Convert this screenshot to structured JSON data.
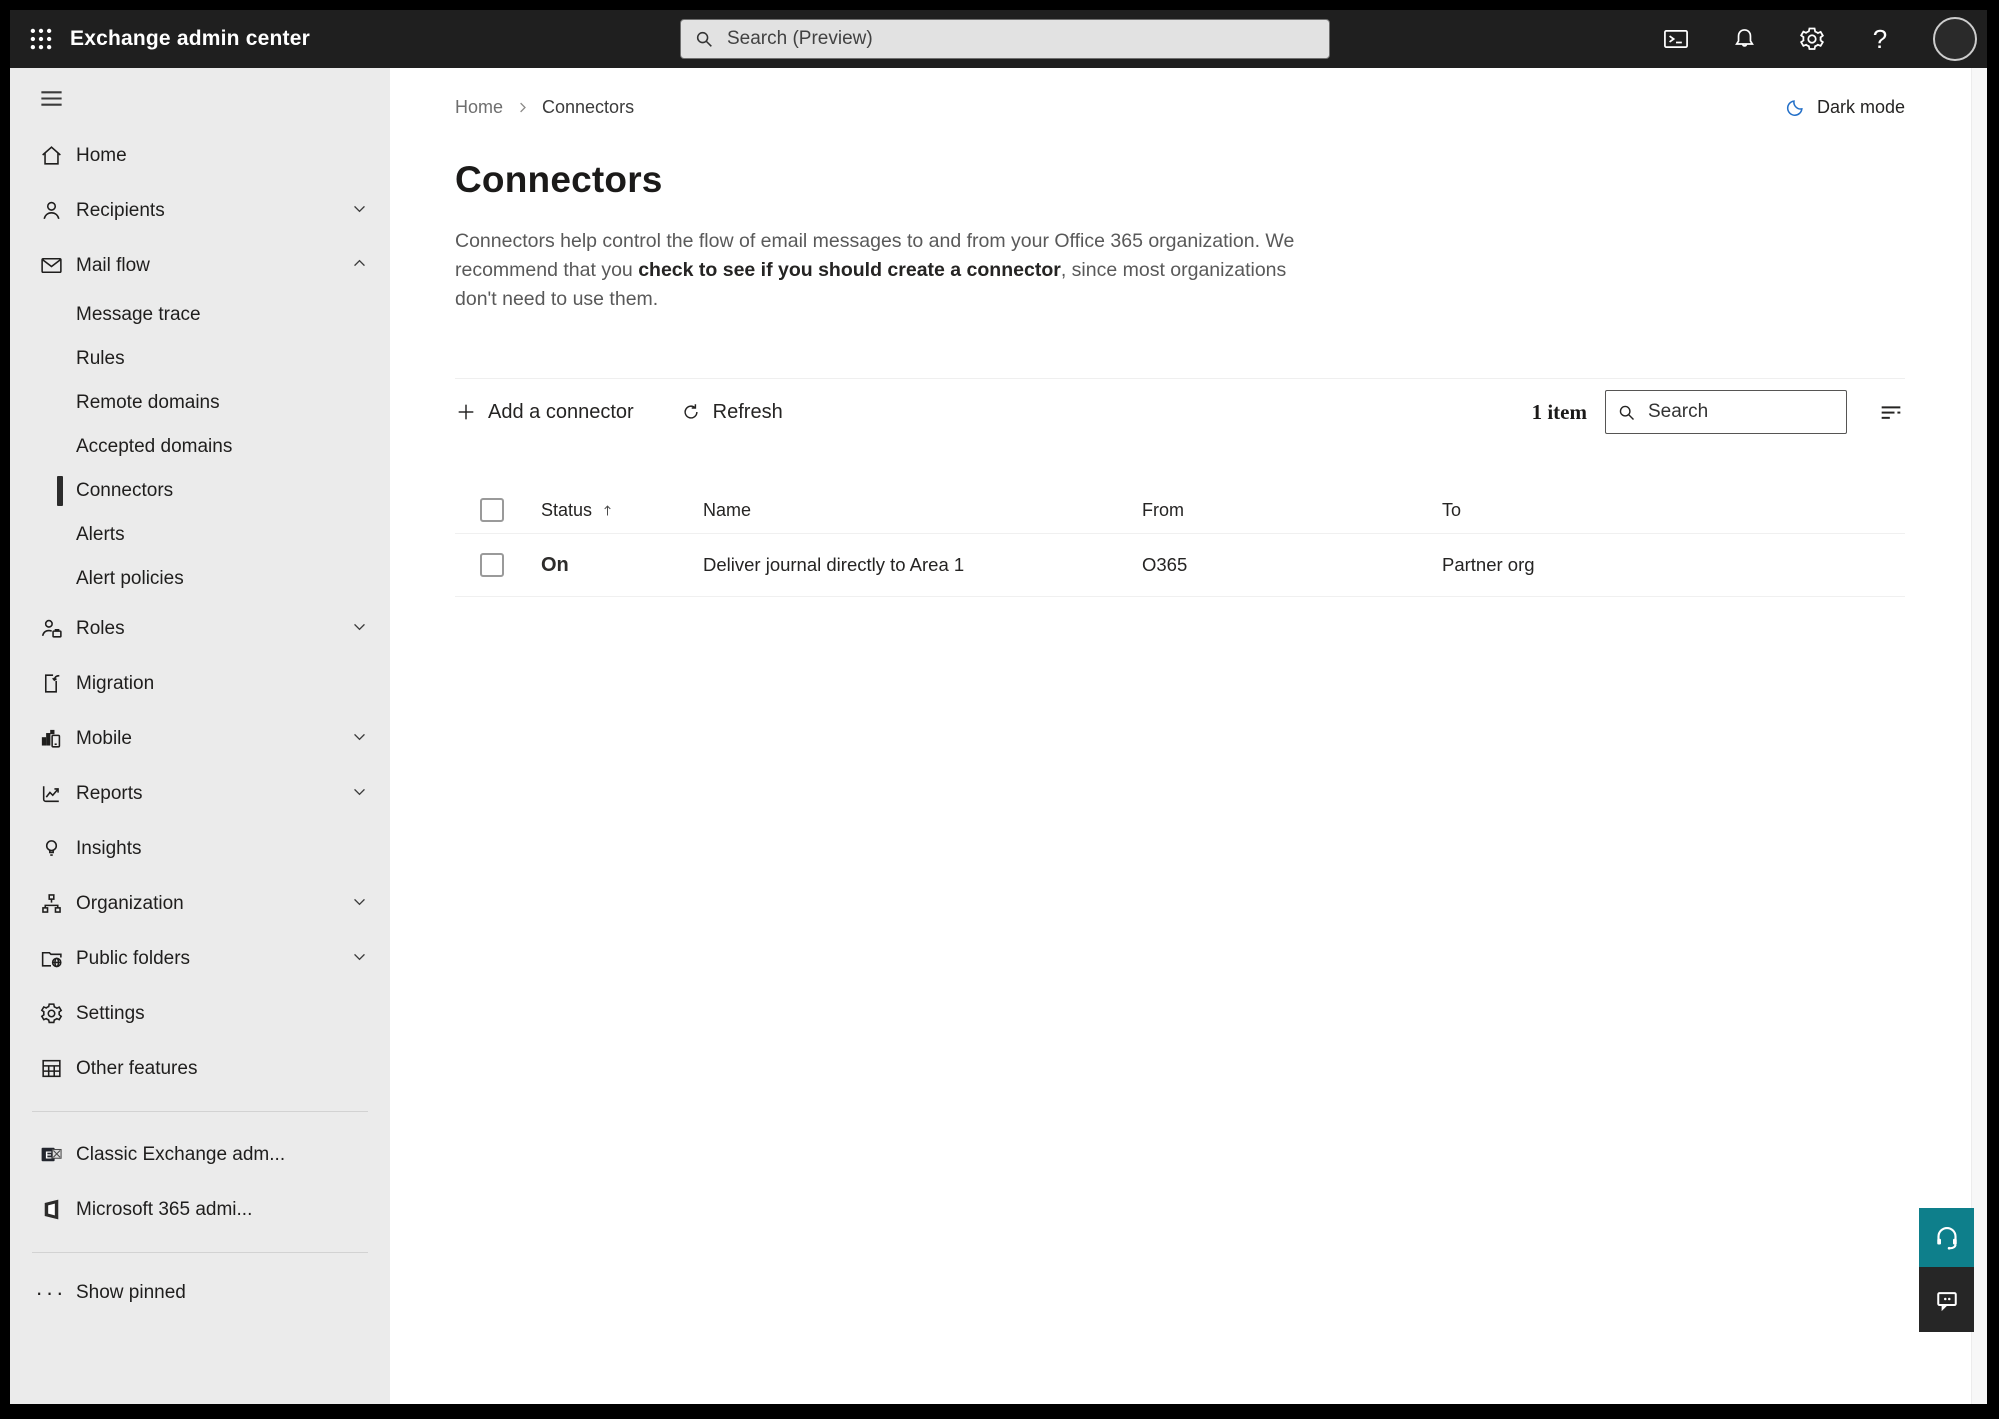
{
  "topbar": {
    "title": "Exchange admin center",
    "search_placeholder": "Search (Preview)"
  },
  "breadcrumb": {
    "home": "Home",
    "current": "Connectors"
  },
  "dark_mode": {
    "label": "Dark mode"
  },
  "page": {
    "title": "Connectors",
    "description_intro": "Connectors help control the flow of email messages to and from your Office 365 organization. We recommend that you ",
    "description_link": "check to see if you should create a connector",
    "description_outro": ", since most organizations don't need to use them."
  },
  "toolbar": {
    "add_label": "Add a connector",
    "refresh_label": "Refresh",
    "item_count": "1 item",
    "search_placeholder": "Search"
  },
  "table": {
    "headers": {
      "status": "Status",
      "name": "Name",
      "from": "From",
      "to": "To"
    },
    "rows": [
      {
        "status": "On",
        "name": "Deliver journal directly to Area 1",
        "from": "O365",
        "to": "Partner org"
      }
    ]
  },
  "sidebar": {
    "items": [
      {
        "label": "Home"
      },
      {
        "label": "Recipients"
      },
      {
        "label": "Mail flow"
      },
      {
        "label": "Message trace"
      },
      {
        "label": "Rules"
      },
      {
        "label": "Remote domains"
      },
      {
        "label": "Accepted domains"
      },
      {
        "label": "Connectors"
      },
      {
        "label": "Alerts"
      },
      {
        "label": "Alert policies"
      },
      {
        "label": "Roles"
      },
      {
        "label": "Migration"
      },
      {
        "label": "Mobile"
      },
      {
        "label": "Reports"
      },
      {
        "label": "Insights"
      },
      {
        "label": "Organization"
      },
      {
        "label": "Public folders"
      },
      {
        "label": "Settings"
      },
      {
        "label": "Other features"
      },
      {
        "label": "Classic Exchange adm..."
      },
      {
        "label": "Microsoft 365 admi..."
      },
      {
        "label": "Show pinned"
      }
    ]
  },
  "colors": {
    "topbar_bg": "#1F1F1F",
    "sidebar_bg": "#EBEBEB",
    "teal_help": "#0E7F8B",
    "moon_blue": "#2470C8"
  }
}
